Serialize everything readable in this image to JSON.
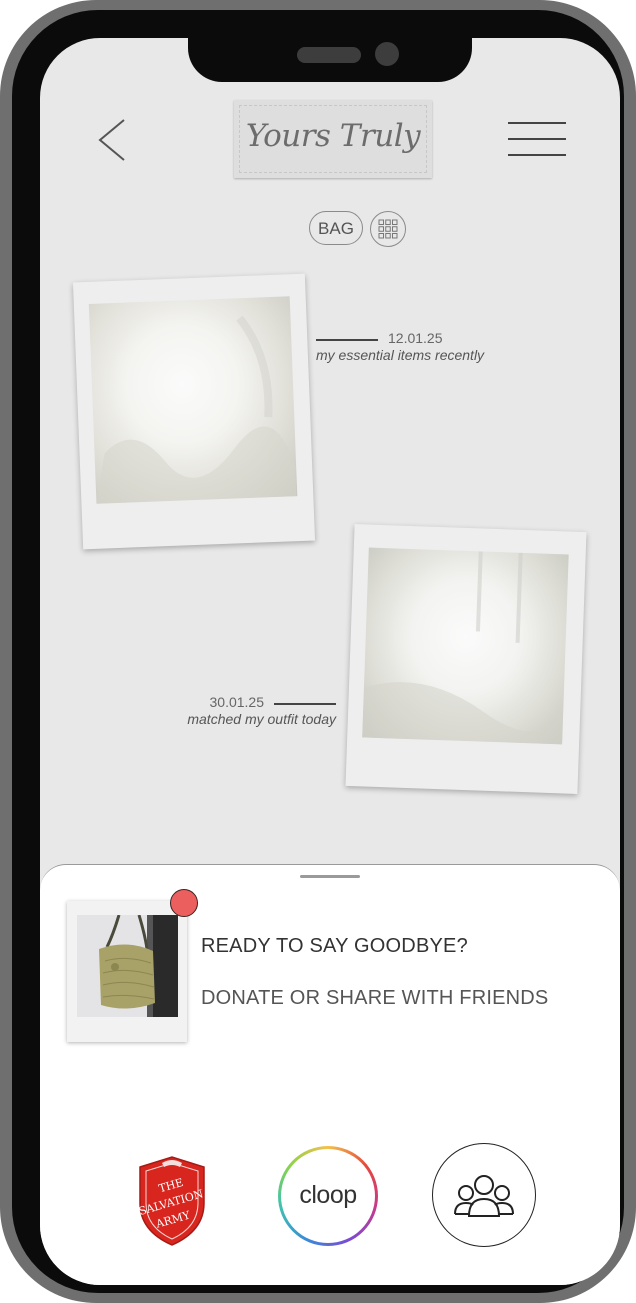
{
  "header": {
    "logo_text": "Yours Truly"
  },
  "filter": {
    "bag_label": "BAG"
  },
  "posts": [
    {
      "date": "12.01.25",
      "note": "my essential items recently"
    },
    {
      "date": "30.01.25",
      "note": "matched my outfit today"
    }
  ],
  "sheet": {
    "prompt": "READY TO SAY GOODBYE?",
    "subprompt": "DONATE OR SHARE WITH FRIENDS",
    "options": {
      "salvation_army": "THE SALVATION ARMY",
      "cloop": "cloop"
    }
  },
  "colors": {
    "screen_bg": "#e8e8e8",
    "notification_badge": "#ec5f5f",
    "phone_frame": "#6f6f6f"
  },
  "icons": [
    "back-arrow-icon",
    "hamburger-menu-icon",
    "grid-view-icon",
    "friends-group-icon",
    "salvation-army-shield-icon"
  ]
}
